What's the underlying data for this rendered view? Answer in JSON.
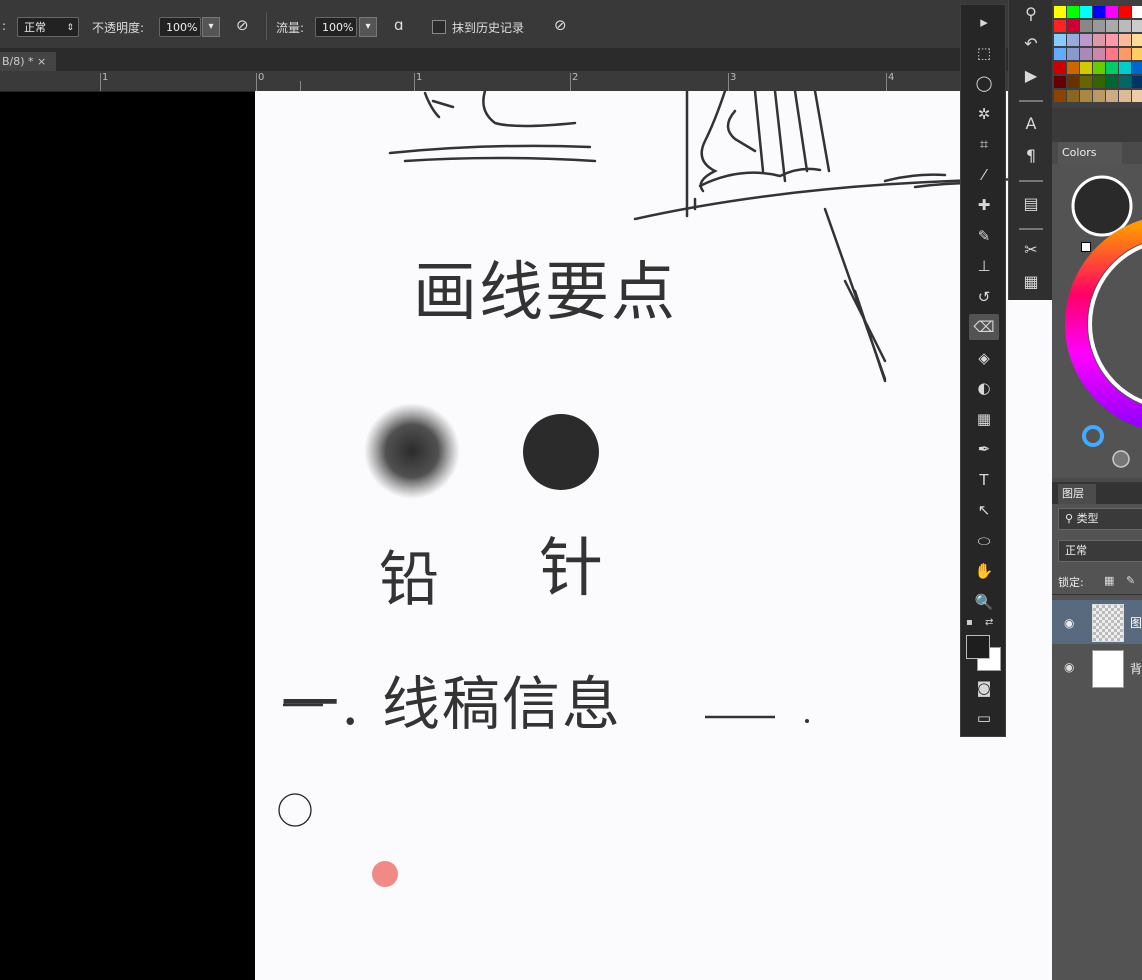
{
  "options_bar": {
    "mode_prefix": ":",
    "mode_value": "正常",
    "opacity_label": "不透明度:",
    "opacity_value": "100%",
    "flow_label": "流量:",
    "flow_value": "100%",
    "history_label": "抹到历史记录"
  },
  "document_tab": {
    "label": "B/8) * ×"
  },
  "ruler": {
    "numbers": [
      "1",
      "0",
      "1",
      "2",
      "3",
      "4"
    ]
  },
  "canvas": {
    "line_note": "画线要点",
    "brush_pencil_label": "铅",
    "brush_pen_label": "针",
    "step_title": "一. 线稿信息"
  },
  "tools": [
    {
      "name": "move-tool-icon",
      "glyph": "▸",
      "active": false
    },
    {
      "name": "marquee-tool-icon",
      "glyph": "⬚",
      "active": false
    },
    {
      "name": "lasso-tool-icon",
      "glyph": "◯",
      "active": false
    },
    {
      "name": "magic-wand-tool-icon",
      "glyph": "✲",
      "active": false
    },
    {
      "name": "crop-tool-icon",
      "glyph": "⌗",
      "active": false
    },
    {
      "name": "eyedropper-tool-icon",
      "glyph": "⁄",
      "active": false
    },
    {
      "name": "healing-brush-tool-icon",
      "glyph": "✚",
      "active": false
    },
    {
      "name": "brush-tool-icon",
      "glyph": "✎",
      "active": false
    },
    {
      "name": "clone-stamp-tool-icon",
      "glyph": "⊥",
      "active": false
    },
    {
      "name": "history-brush-tool-icon",
      "glyph": "↺",
      "active": false
    },
    {
      "name": "eraser-tool-icon",
      "glyph": "⌫",
      "active": true
    },
    {
      "name": "paint-bucket-tool-icon",
      "glyph": "◈",
      "active": false
    },
    {
      "name": "dodge-tool-icon",
      "glyph": "◐",
      "active": false
    },
    {
      "name": "blur-tool-icon",
      "glyph": "▦",
      "active": false
    },
    {
      "name": "pen-tool-icon",
      "glyph": "✒",
      "active": false
    },
    {
      "name": "type-tool-icon",
      "glyph": "T",
      "active": false
    },
    {
      "name": "path-selection-tool-icon",
      "glyph": "↖",
      "active": false
    },
    {
      "name": "ellipse-tool-icon",
      "glyph": "⬭",
      "active": false
    },
    {
      "name": "hand-tool-icon",
      "glyph": "✋",
      "active": false
    },
    {
      "name": "zoom-tool-icon",
      "glyph": "🔍",
      "active": false
    }
  ],
  "colors": {
    "foreground": "#1e1e1e",
    "background": "#ffffff",
    "canvas_bg": "#fbfbfd",
    "marker_dot": "#f08a86",
    "ink": "#2b2b2b"
  },
  "swatch_colors": [
    "#ffff00",
    "#00ff00",
    "#00ffff",
    "#0000ff",
    "#ff00ff",
    "#ff0000",
    "#ffffff",
    "#ff2222",
    "#cc0033",
    "#888888",
    "#999999",
    "#aaaaaa",
    "#bbbbbb",
    "#cccccc",
    "#88ccff",
    "#99aadd",
    "#bb99cc",
    "#dd99aa",
    "#ff99aa",
    "#ffbb99",
    "#ffdd99",
    "#66aaff",
    "#8899cc",
    "#aa88bb",
    "#cc88aa",
    "#ff7788",
    "#ff9966",
    "#ffcc66",
    "#cc0000",
    "#cc6600",
    "#cccc00",
    "#66cc00",
    "#00cc66",
    "#00cccc",
    "#0066cc",
    "#660000",
    "#663300",
    "#666600",
    "#336600",
    "#006633",
    "#006666",
    "#003366",
    "#884400",
    "#886622",
    "#aa8844",
    "#bb9966",
    "#ccaa88",
    "#ddbb99",
    "#eeccaa"
  ],
  "colors_panel": {
    "tab_label": "Colors"
  },
  "layers_panel": {
    "tab_label": "图层",
    "filter_label": "类型",
    "blend_mode": "正常",
    "lock_label": "锁定:",
    "layer1_name": "图",
    "layer2_name": "背"
  }
}
